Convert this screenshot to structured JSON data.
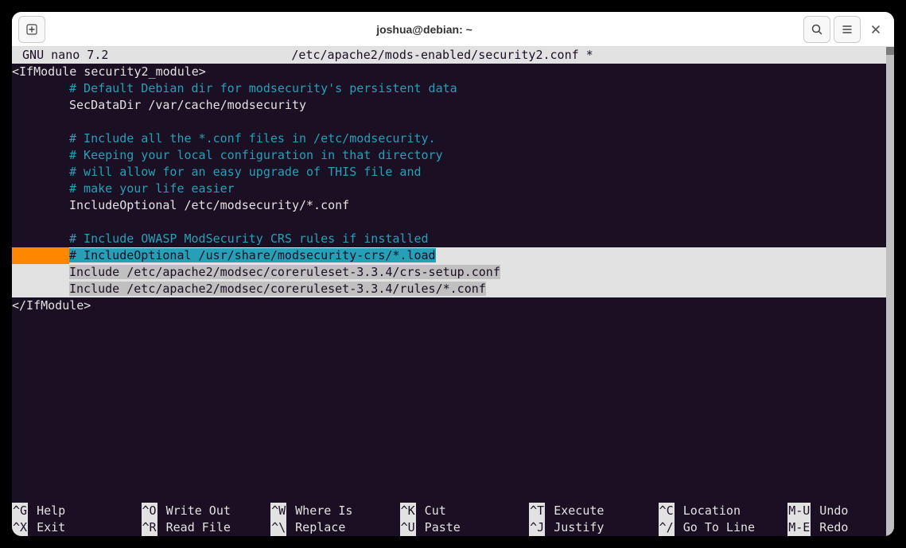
{
  "titlebar": {
    "title": "joshua@debian: ~"
  },
  "nano": {
    "header_left": " GNU nano 7.2",
    "header_file": "/etc/apache2/mods-enabled/security2.conf *"
  },
  "content": {
    "l1": "<IfModule security2_module>",
    "l2": "# Default Debian dir for modsecurity's persistent data",
    "l3": "SecDataDir /var/cache/modsecurity",
    "l4": "# Include all the *.conf files in /etc/modsecurity.",
    "l5": "# Keeping your local configuration in that directory",
    "l6": "# will allow for an easy upgrade of THIS file and",
    "l7": "# make your life easier",
    "l8": "IncludeOptional /etc/modsecurity/*.conf",
    "l9": "# Include OWASP ModSecurity CRS rules if installed",
    "l10": "# IncludeOptional /usr/share/modsecurity-crs/*.load",
    "l11_cursor": "I",
    "l11_rest": "nclude /etc/apache2/modsec/coreruleset-3.3.4/crs-setup.conf",
    "l12": "Include /etc/apache2/modsec/coreruleset-3.3.4/rules/*.conf",
    "l13": "</IfModule>"
  },
  "help": {
    "r1": [
      {
        "k": "^G",
        "l": " Help"
      },
      {
        "k": "^O",
        "l": " Write Out"
      },
      {
        "k": "^W",
        "l": " Where Is"
      },
      {
        "k": "^K",
        "l": " Cut"
      },
      {
        "k": "^T",
        "l": " Execute"
      },
      {
        "k": "^C",
        "l": " Location"
      },
      {
        "k": "M-U",
        "l": " Undo"
      }
    ],
    "r2": [
      {
        "k": "^X",
        "l": " Exit"
      },
      {
        "k": "^R",
        "l": " Read File"
      },
      {
        "k": "^\\",
        "l": " Replace"
      },
      {
        "k": "^U",
        "l": " Paste"
      },
      {
        "k": "^J",
        "l": " Justify"
      },
      {
        "k": "^/",
        "l": " Go To Line"
      },
      {
        "k": "M-E",
        "l": " Redo"
      }
    ]
  }
}
